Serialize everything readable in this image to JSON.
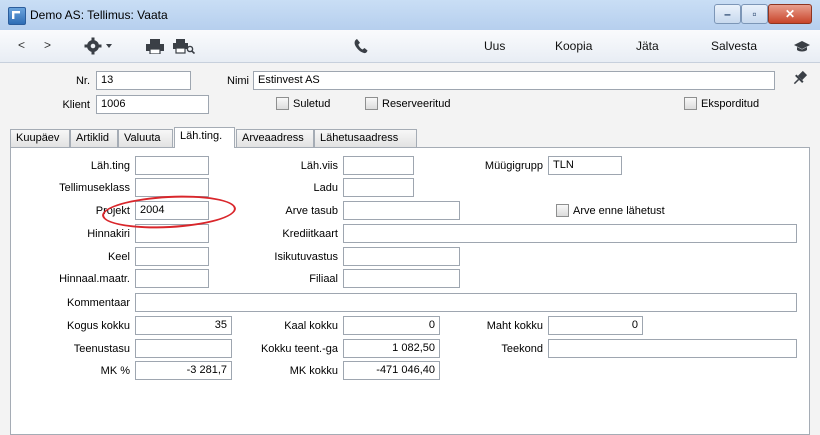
{
  "window": {
    "title": "Demo AS: Tellimus: Vaata"
  },
  "toolbar": {
    "new": "Uus",
    "copy": "Koopia",
    "skip": "Jäta",
    "save": "Salvesta"
  },
  "header": {
    "nr_label": "Nr.",
    "nr_value": "13",
    "name_label": "Nimi",
    "name_value": "Estinvest AS",
    "client_label": "Klient",
    "client_value": "1006",
    "closed_label": "Suletud",
    "reserved_label": "Reserveeritud",
    "exported_label": "Eksporditud"
  },
  "tabs": [
    "Kuupäev",
    "Artiklid",
    "Valuuta",
    "Läh.ting.",
    "Arveaadress",
    "Lähetusaadress"
  ],
  "active_tab": "Läh.ting.",
  "form": {
    "delivery_terms_label": "Läh.ting",
    "delivery_terms_value": "",
    "delivery_mode_label": "Läh.viis",
    "delivery_mode_value": "",
    "sales_group_label": "Müügigrupp",
    "sales_group_value": "TLN",
    "order_class_label": "Tellimuseklass",
    "order_class_value": "",
    "warehouse_label": "Ladu",
    "warehouse_value": "",
    "project_label": "Projekt",
    "project_value": "2004",
    "invoice_pays_label": "Arve tasub",
    "invoice_pays_value": "",
    "invoice_before_label": "Arve enne lähetust",
    "price_list_label": "Hinnakiri",
    "price_list_value": "",
    "credit_card_label": "Krediitkaart",
    "credit_card_value": "",
    "language_label": "Keel",
    "language_value": "",
    "responsibility_label": "Isikutuvastus",
    "responsibility_value": "",
    "price_formula_label": "Hinnaal.maatr.",
    "price_formula_value": "",
    "branch_label": "Filiaal",
    "branch_value": "",
    "comment_label": "Kommentaar",
    "comment_value": "",
    "qty_total_label": "Kogus kokku",
    "qty_total_value": "35",
    "weight_total_label": "Kaal kokku",
    "weight_total_value": "0",
    "volume_total_label": "Maht kokku",
    "volume_total_value": "0",
    "service_level_label": "Teenustasu",
    "service_level_value": "",
    "service_total_label": "Kokku teent.-ga",
    "service_total_value": "1 082,50",
    "route_label": "Teekond",
    "route_value": "",
    "mk_pct_label": "MK %",
    "mk_pct_value": "-3 281,7",
    "mk_total_label": "MK kokku",
    "mk_total_value": "-471 046,40"
  }
}
